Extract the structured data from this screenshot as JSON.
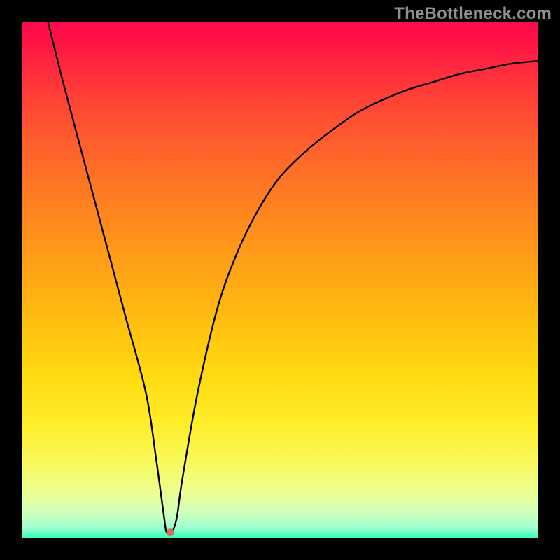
{
  "watermark": "TheBottleneck.com",
  "chart_data": {
    "type": "line",
    "title": "",
    "xlabel": "",
    "ylabel": "",
    "xlim": [
      0,
      100
    ],
    "ylim": [
      0,
      100
    ],
    "grid": false,
    "series": [
      {
        "name": "bottleneck-curve",
        "color": "#000000",
        "x": [
          5,
          8,
          12,
          16,
          20,
          24,
          26,
          27.5,
          28,
          29,
          30,
          31,
          34,
          38,
          42,
          46,
          50,
          55,
          60,
          65,
          70,
          75,
          80,
          85,
          90,
          95,
          100
        ],
        "y": [
          100,
          88,
          73,
          58,
          43,
          28,
          15,
          4,
          1,
          1,
          4,
          11,
          28,
          45,
          56,
          64,
          70,
          75,
          79,
          82.5,
          85,
          87,
          88.5,
          90,
          91,
          92,
          92.5
        ]
      }
    ],
    "marker": {
      "x": 28.7,
      "y": 1.0,
      "color": "#d07060",
      "size": 11
    },
    "background_gradient": {
      "top": "#ff0a4e",
      "mid": "#ffdd14",
      "bottom": "#37ffb9"
    }
  }
}
